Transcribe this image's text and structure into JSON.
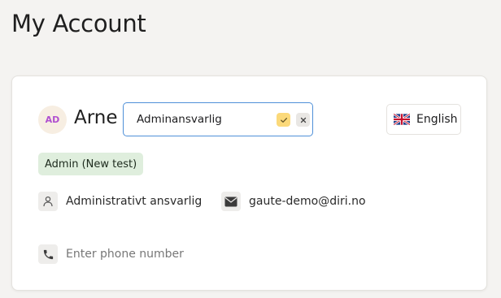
{
  "page": {
    "title": "My Account"
  },
  "profile": {
    "avatar_initials": "AD",
    "avatar_text_color": "#b04fd0",
    "first_name": "Arne",
    "name_input_value": "Adminansvarlig",
    "role_badge": "Admin (New test)",
    "job_title": "Administrativt ansvarlig",
    "email": "gaute-demo@diri.no",
    "phone_placeholder": "Enter phone number"
  },
  "language": {
    "label": "English",
    "flag_icon": "uk-flag-icon"
  },
  "icons": {
    "confirm": "check-icon",
    "cancel": "close-icon",
    "job": "person-icon",
    "email": "envelope-icon",
    "phone": "phone-icon"
  },
  "colors": {
    "input_focus_border": "#4f90d8",
    "confirm_bg": "#fbd97a",
    "badge_bg": "#dfeedd"
  }
}
